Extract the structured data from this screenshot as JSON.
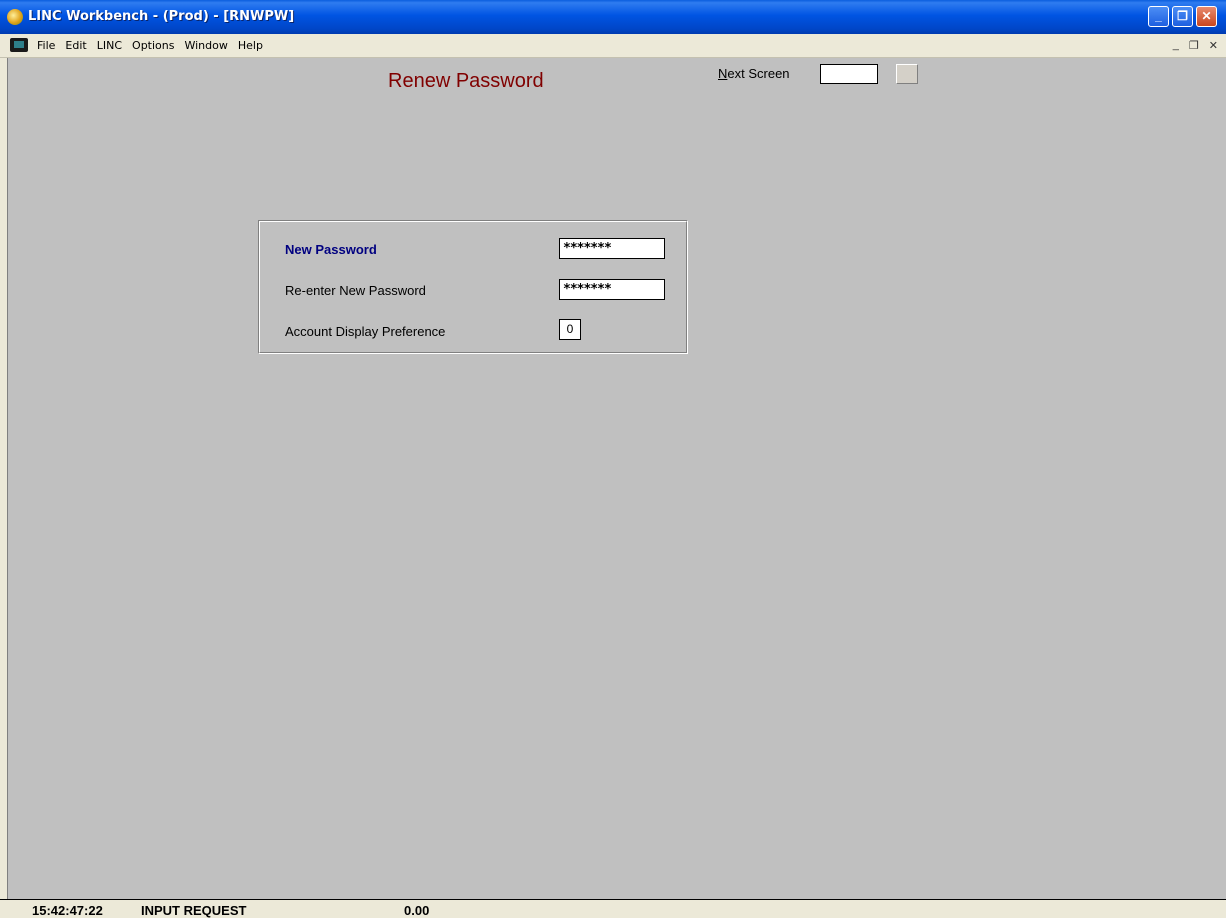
{
  "window": {
    "title": "LINC Workbench - (Prod) - [RNWPW]",
    "minimize": "_",
    "restore": "❐",
    "close": "✕"
  },
  "menubar": {
    "items": [
      "File",
      "Edit",
      "LINC",
      "Options",
      "Window",
      "Help"
    ],
    "mdi_minimize": "_",
    "mdi_restore": "❐",
    "mdi_close": "✕"
  },
  "screen": {
    "title": "Renew Password",
    "next_screen_label_first": "N",
    "next_screen_label_rest": "ext Screen",
    "next_screen_value": ""
  },
  "form": {
    "new_password_label": "New Password",
    "new_password_value": "*******",
    "reenter_label": "Re-enter New Password",
    "reenter_value": "*******",
    "account_pref_label": "Account Display Preference",
    "account_pref_value": "0"
  },
  "status": {
    "time": "15:42:47:22",
    "mode": "INPUT REQUEST",
    "amount": "0.00"
  },
  "colors": {
    "title_red": "#800000",
    "label_blue": "#000080",
    "client_bg": "#c0c0c0"
  }
}
